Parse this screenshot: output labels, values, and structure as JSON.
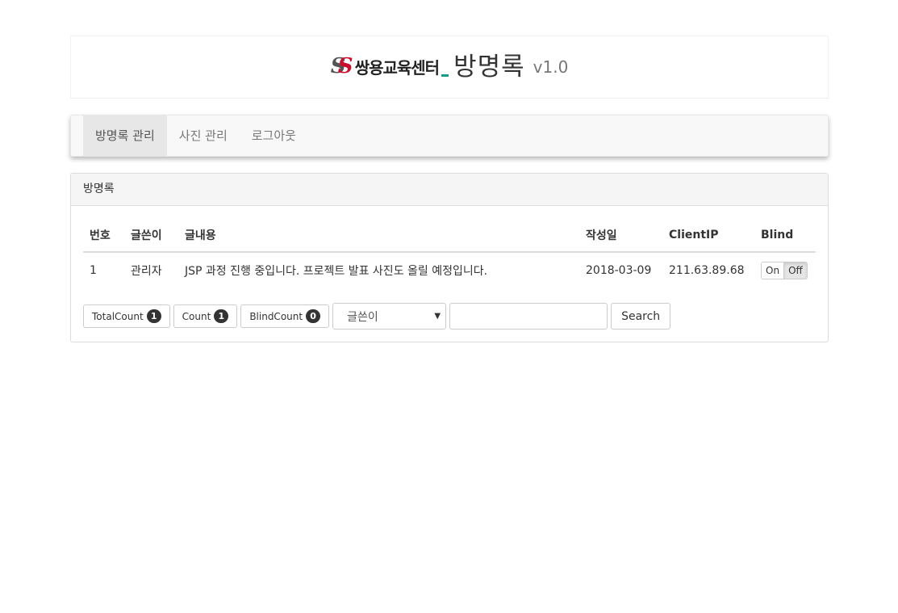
{
  "header": {
    "logo_text": "쌍용교육센터",
    "title": "방명록",
    "version": "v1.0"
  },
  "nav": {
    "items": [
      {
        "label": "방명록 관리",
        "active": true
      },
      {
        "label": "사진 관리",
        "active": false
      },
      {
        "label": "로그아웃",
        "active": false
      }
    ]
  },
  "panel": {
    "title": "방명록",
    "columns": [
      "번호",
      "글쓴이",
      "글내용",
      "작성일",
      "ClientIP",
      "Blind"
    ],
    "rows": [
      {
        "no": "1",
        "writer": "관리자",
        "content": "JSP 과정 진행 중입니다. 프로젝트 발표 사진도 올릴 예정입니다.",
        "date": "2018-03-09",
        "ip": "211.63.89.68",
        "blind_on": "On",
        "blind_off": "Off",
        "blind_state": "Off"
      }
    ]
  },
  "controls": {
    "total_count_label": "TotalCount",
    "total_count": "1",
    "count_label": "Count",
    "count": "1",
    "blind_count_label": "BlindCount",
    "blind_count": "0",
    "select_value": "글쓴이",
    "search_value": "",
    "search_button": "Search"
  },
  "colors": {
    "logo_red": "#c8102e",
    "logo_teal": "#1b9a8a",
    "badge": "#333333"
  }
}
